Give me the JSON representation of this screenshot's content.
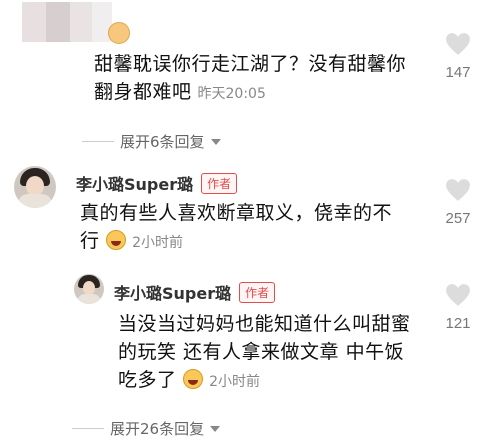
{
  "comments": [
    {
      "text_line1": "甜馨耽误你行走江湖了？没有甜馨你",
      "text_line2": "翻身都难吧",
      "time": "昨天20:05",
      "likes": "147",
      "expand": "展开6条回复"
    },
    {
      "user": "李小璐Super璐",
      "tag": "作者",
      "text_line1": "真的有些人喜欢断章取义，侥幸的不",
      "text_line2": "行",
      "time": "2小时前",
      "likes": "257"
    },
    {
      "user": "李小璐Super璐",
      "tag": "作者",
      "text_line1": "当没当过妈妈也能知道什么叫甜蜜",
      "text_line2": "的玩笑 还有人拿来做文章 中午饭",
      "text_line3": "吃多了",
      "time": "2小时前",
      "likes": "121",
      "expand": "展开26条回复"
    }
  ],
  "icons": {
    "like": "heart-icon",
    "expand": "chevron-down-icon",
    "emoji": "laughing-emoji-icon"
  }
}
